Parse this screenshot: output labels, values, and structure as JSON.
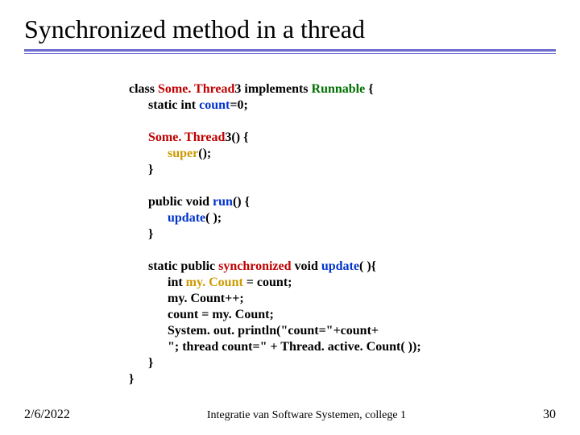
{
  "slide": {
    "title": "Synchronized method in a thread"
  },
  "code": {
    "l1a": "class ",
    "l1b": "Some. Thread",
    "l1c": "3",
    "l1d": " implements ",
    "l1e": "Runnable",
    "l1f": " {",
    "l2a": "static int ",
    "l2b": "count",
    "l2c": "=0;",
    "l3a": "Some. Thread",
    "l3b": "3() {",
    "l4a": "super",
    "l4b": "();",
    "l5": "}",
    "l6a": "public void ",
    "l6b": "run",
    "l6c": "() {",
    "l7a": "update",
    "l7b": "( );",
    "l8": "}",
    "l9a": "static public ",
    "l9b": "synchronized ",
    "l9c": "void ",
    "l9d": "update",
    "l9e": "( ){",
    "l10a": "int ",
    "l10b": "my. Count",
    "l10c": " = count;",
    "l11": "my. Count++;",
    "l12": "count = my. Count;",
    "l13": "System. out. println(\"count=\"+count+",
    "l14": "\"; thread count=\" + Thread. active. Count( ));",
    "l15": "}",
    "l16": "}"
  },
  "footer": {
    "date": "2/6/2022",
    "course": "Integratie van Software Systemen, college 1",
    "page": "30"
  }
}
